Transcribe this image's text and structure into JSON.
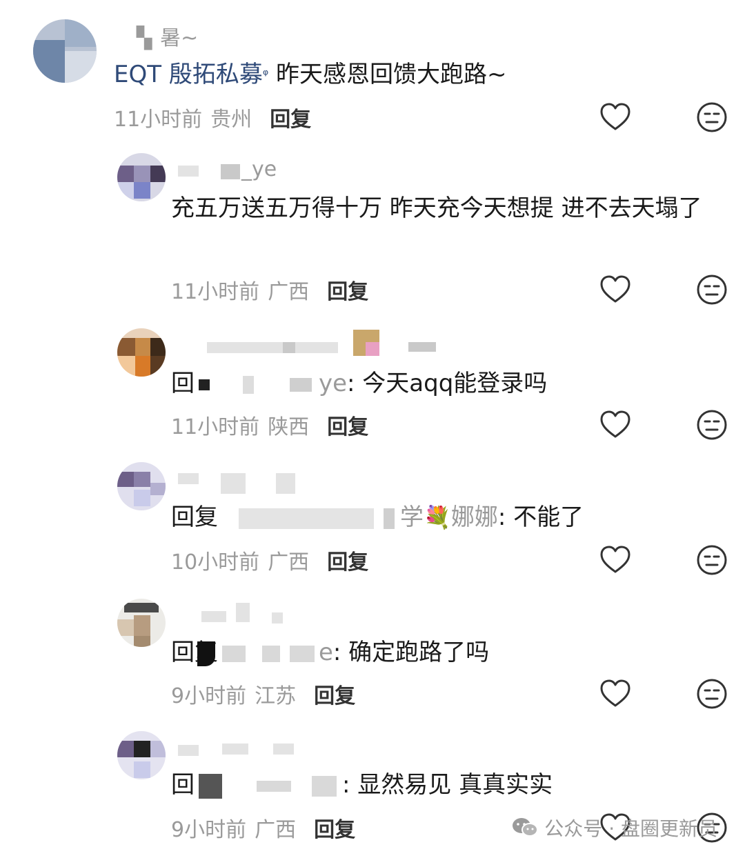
{
  "comments": [
    {
      "username": "▝▖暑~",
      "mention": "EQT 殷拓私募",
      "text": "  昨天感恩回馈大跑路~",
      "time": "11小时前",
      "location": "贵州",
      "reply_label": "回复"
    },
    {
      "username": "_ye",
      "text": "充五万送五万得十万 昨天充今天想提 进不去天塌了",
      "time": "11小时前",
      "location": "广西",
      "reply_label": "回复"
    },
    {
      "reply_prefix": "回",
      "reply_target_tail": "ye",
      "text": ": 今天aqq能登录吗",
      "time": "11小时前",
      "location": "陕西",
      "reply_label": "回复"
    },
    {
      "reply_prefix": "回复",
      "reply_target_tail": "学",
      "reply_target_name": "娜娜",
      "text": ": 不能了",
      "time": "10小时前",
      "location": "广西",
      "reply_label": "回复"
    },
    {
      "reply_prefix": "回复",
      "reply_target_tail": "e",
      "text": ": 确定跑路了吗",
      "time": "9小时前",
      "location": "江苏",
      "reply_label": "回复"
    },
    {
      "reply_prefix": "回",
      "reply_target_tail": "",
      "text": ": 显然易见 真真实实",
      "time": "9小时前",
      "location": "广西",
      "reply_label": "回复"
    }
  ],
  "icons": {
    "like": "heart-outline-icon",
    "dislike": "meh-face-icon",
    "watermark": "wechat-icon"
  },
  "watermark": {
    "text": "公众号 · 盘圈更新员"
  },
  "colors": {
    "mention": "#2f4a78",
    "muted": "#9a9a9a",
    "text": "#1a1a1a"
  }
}
